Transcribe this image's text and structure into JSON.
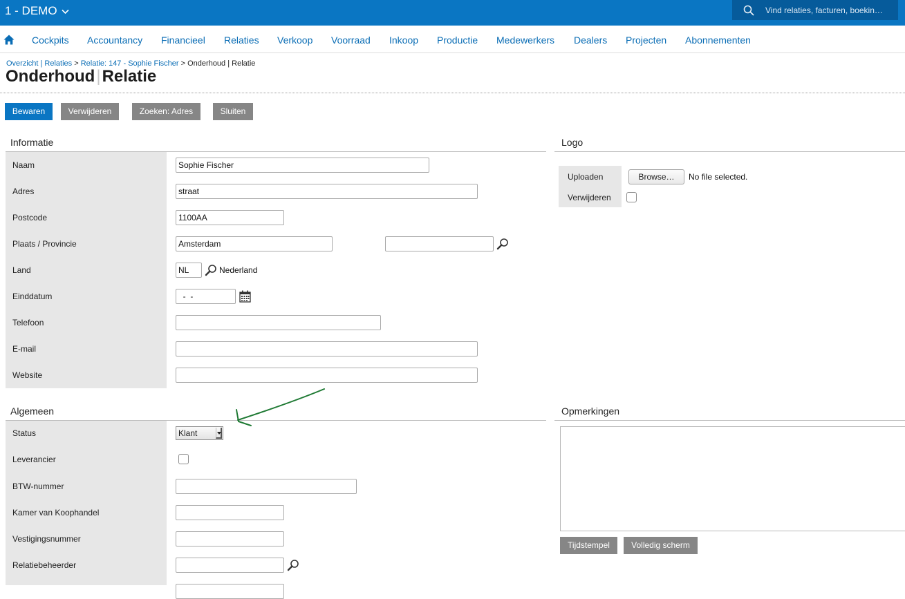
{
  "header": {
    "company": "1 - DEMO",
    "search_placeholder": "Vind relaties, facturen, boekin…"
  },
  "nav": [
    "Cockpits",
    "Accountancy",
    "Financieel",
    "Relaties",
    "Verkoop",
    "Voorraad",
    "Inkoop",
    "Productie",
    "Medewerkers",
    "Dealers",
    "Projecten",
    "Abonnementen"
  ],
  "breadcrumb": {
    "link1": "Overzicht | Relaties",
    "sep1": " > ",
    "link2": "Relatie: 147 - Sophie Fischer",
    "sep2": " > ",
    "current": "Onderhoud | Relatie"
  },
  "title": {
    "part1": "Onderhoud",
    "separator": "|",
    "part2": "Relatie"
  },
  "toolbar": {
    "save": "Bewaren",
    "delete": "Verwijderen",
    "search_address": "Zoeken: Adres",
    "close": "Sluiten"
  },
  "informatie": {
    "title": "Informatie",
    "labels": {
      "naam": "Naam",
      "adres": "Adres",
      "postcode": "Postcode",
      "plaats": "Plaats / Provincie",
      "land": "Land",
      "einddatum": "Einddatum",
      "telefoon": "Telefoon",
      "email": "E-mail",
      "website": "Website"
    },
    "values": {
      "naam": "Sophie Fischer",
      "adres": "straat",
      "postcode": "1100AA",
      "plaats": "Amsterdam",
      "provincie": "",
      "land_code": "NL",
      "land_name": "Nederland",
      "einddatum": "  -  -",
      "telefoon": "",
      "email": "",
      "website": ""
    }
  },
  "logo": {
    "title": "Logo",
    "upload_label": "Uploaden",
    "browse": "Browse…",
    "no_file": "No file selected.",
    "delete_label": "Verwijderen"
  },
  "algemeen": {
    "title": "Algemeen",
    "labels": {
      "status": "Status",
      "leverancier": "Leverancier",
      "btw": "BTW-nummer",
      "kvk": "Kamer van Koophandel",
      "vestiging": "Vestigingsnummer",
      "beheerder": "Relatiebeheerder"
    },
    "values": {
      "status": "Klant"
    }
  },
  "opmerkingen": {
    "title": "Opmerkingen",
    "timestamp": "Tijdstempel",
    "fullscreen": "Volledig scherm"
  },
  "colors": {
    "topbar": "#0a76c3",
    "search_bg": "#065b9b",
    "link": "#0a6db5",
    "primary_button": "#0a76c3",
    "grey_button": "#868686",
    "label_bg": "#e7e7e7",
    "annotation_arrow": "#1f7a34"
  }
}
